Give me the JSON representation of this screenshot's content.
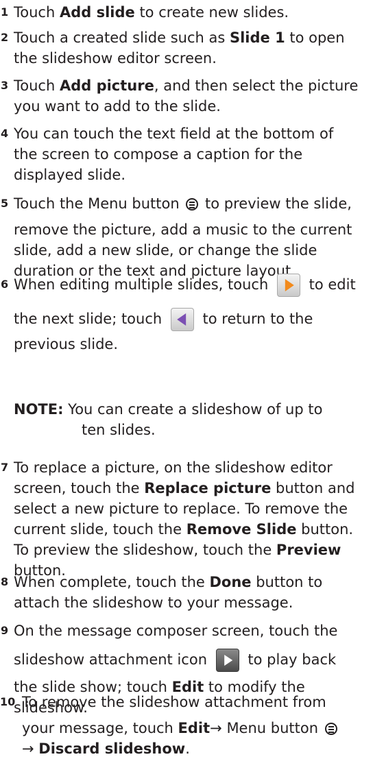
{
  "steps": [
    {
      "num": "1",
      "lines": [
        [
          "Touch ",
          {
            "b": "Add slide"
          },
          " to create new slides."
        ]
      ]
    },
    {
      "num": "2",
      "lines": [
        [
          "Touch a created slide such as ",
          {
            "b": "Slide 1"
          },
          " to open"
        ],
        [
          "the slideshow editor screen."
        ]
      ]
    },
    {
      "num": "3",
      "lines": [
        [
          "Touch ",
          {
            "b": "Add picture"
          },
          ", and then select the picture"
        ],
        [
          "you want to add to the slide."
        ]
      ]
    },
    {
      "num": "4",
      "lines": [
        [
          "You can touch the text field at the bottom of"
        ],
        [
          "the screen to compose a caption for the"
        ],
        [
          "displayed slide."
        ]
      ]
    },
    {
      "num": "5",
      "lines": [
        [
          "Touch the Menu button ",
          {
            "icon": "menu"
          },
          " to preview the slide,"
        ],
        [
          "remove the picture, add a music to the current"
        ],
        [
          "slide, add a new slide, or change the slide"
        ],
        [
          "duration or the text and picture layout."
        ]
      ]
    },
    {
      "num": "6",
      "lines": [
        [
          "When editing multiple slides, touch ",
          {
            "icon": "next"
          },
          " to edit"
        ],
        [
          "the next slide; touch ",
          {
            "icon": "prev"
          },
          " to return to the"
        ],
        [
          "previous slide."
        ]
      ]
    },
    {
      "num": "7",
      "lines": [
        [
          "To replace a picture, on the slideshow editor"
        ],
        [
          "screen, touch the ",
          {
            "b": "Replace picture"
          },
          " button and"
        ],
        [
          "select a new picture to replace. To remove the"
        ],
        [
          "current slide, touch the ",
          {
            "b": "Remove Slide"
          },
          " button."
        ],
        [
          "To preview the slideshow, touch the ",
          {
            "b": "Preview"
          }
        ],
        [
          "button."
        ]
      ]
    },
    {
      "num": "8",
      "lines": [
        [
          "When complete, touch the ",
          {
            "b": "Done"
          },
          " button to"
        ],
        [
          "attach the slideshow to your message."
        ]
      ]
    },
    {
      "num": "9",
      "lines": [
        [
          "On the message composer screen, touch the"
        ],
        [
          "slideshow attachment icon ",
          {
            "icon": "play"
          },
          " to play back"
        ],
        [
          "the slide show; touch ",
          {
            "b": "Edit"
          },
          " to modify the"
        ],
        [
          "slideshow."
        ]
      ]
    },
    {
      "num": "10",
      "lines": [
        [
          "To remove the slideshow attachment from"
        ],
        [
          "your message, touch ",
          {
            "b": "Edit"
          },
          "→ Menu button ",
          {
            "icon": "menu"
          }
        ],
        [
          "→ ",
          {
            "b": "Discard slideshow"
          },
          "."
        ]
      ]
    }
  ],
  "note": {
    "label": "NOTE:",
    "line1": " You can create a slideshow of up to",
    "line2": "ten slides."
  }
}
